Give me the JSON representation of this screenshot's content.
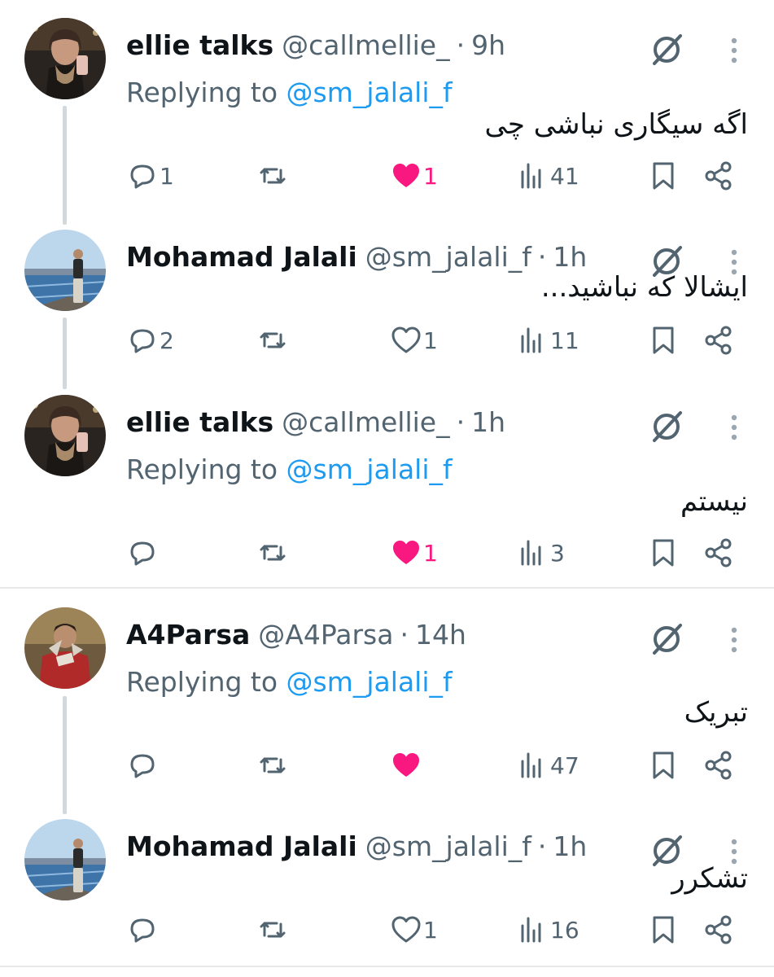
{
  "colors": {
    "accent": "#1d9bf0",
    "like": "#f91880",
    "muted": "#536471",
    "text": "#0f1419",
    "thread_line": "#cfd9de"
  },
  "tweets": [
    {
      "display_name": "ellie talks",
      "handle": "@callmellie_",
      "separator": "·",
      "time": "9h",
      "replying_prefix": "Replying to",
      "replying_to": "@sm_jalali_f",
      "text": "اگه سیگاری نباشی چی",
      "avatar_icon": "profile-photo",
      "actions": {
        "replies": "1",
        "reposts": "",
        "likes": "1",
        "liked": true,
        "views": "41"
      }
    },
    {
      "display_name": "Mohamad Jalali",
      "handle": "@sm_jalali_f",
      "separator": "·",
      "time": "1h",
      "text": "ایشالا که نباشید...",
      "avatar_icon": "profile-photo",
      "actions": {
        "replies": "2",
        "reposts": "",
        "likes": "1",
        "liked": false,
        "views": "11"
      }
    },
    {
      "display_name": "ellie talks",
      "handle": "@callmellie_",
      "separator": "·",
      "time": "1h",
      "replying_prefix": "Replying to",
      "replying_to": "@sm_jalali_f",
      "text": "نیستم",
      "avatar_icon": "profile-photo",
      "actions": {
        "replies": "",
        "reposts": "",
        "likes": "1",
        "liked": true,
        "views": "3"
      }
    },
    {
      "display_name": "A4Parsa",
      "handle": "@A4Parsa",
      "separator": "·",
      "time": "14h",
      "replying_prefix": "Replying to",
      "replying_to": "@sm_jalali_f",
      "text": "تبریک",
      "avatar_icon": "profile-photo",
      "actions": {
        "replies": "",
        "reposts": "",
        "likes": "",
        "liked": true,
        "views": "47"
      }
    },
    {
      "display_name": "Mohamad Jalali",
      "handle": "@sm_jalali_f",
      "separator": "·",
      "time": "1h",
      "text": "تشکرر",
      "avatar_icon": "profile-photo",
      "actions": {
        "replies": "",
        "reposts": "",
        "likes": "1",
        "liked": false,
        "views": "16"
      }
    }
  ],
  "icons": {
    "reply": "reply-icon",
    "repost": "repost-icon",
    "like": "heart-icon",
    "views": "views-icon",
    "bookmark": "bookmark-icon",
    "share": "share-icon",
    "grok": "grok-icon",
    "more": "more-icon"
  }
}
